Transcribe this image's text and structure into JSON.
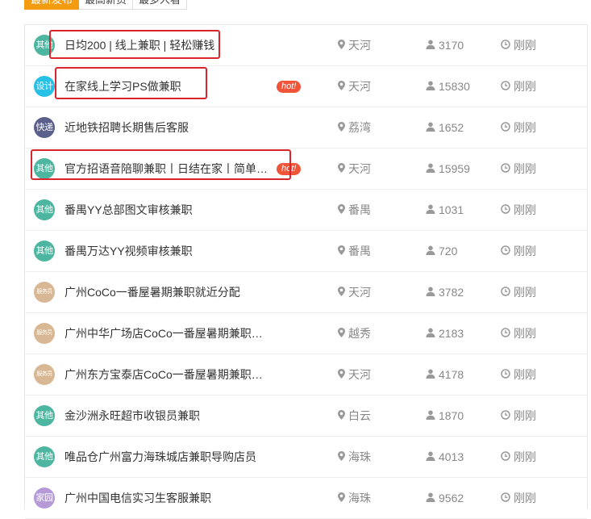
{
  "tabs": [
    "最新发布",
    "最高薪资",
    "最多人看"
  ],
  "jobs": [
    {
      "badge": "其他",
      "badge_kind": "other",
      "title": "日均200 | 线上兼职 | 轻松赚钱",
      "hot": "",
      "location": "天河",
      "views": "3170",
      "time": "刚刚"
    },
    {
      "badge": "设计",
      "badge_kind": "design",
      "title": "在家线上学习PS做兼职",
      "hot": "hot!",
      "location": "天河",
      "views": "15830",
      "time": "刚刚"
    },
    {
      "badge": "快递",
      "badge_kind": "express",
      "title": "近地铁招聘长期售后客服",
      "hot": "",
      "location": "荔湾",
      "views": "1652",
      "time": "刚刚"
    },
    {
      "badge": "其他",
      "badge_kind": "other",
      "title": "官方招语音陪聊兼职丨日结在家丨简单…",
      "hot": "hot!",
      "location": "天河",
      "views": "15959",
      "time": "刚刚"
    },
    {
      "badge": "其他",
      "badge_kind": "other",
      "title": "番禺YY总部图文审核兼职",
      "hot": "",
      "location": "番禺",
      "views": "1031",
      "time": "刚刚"
    },
    {
      "badge": "其他",
      "badge_kind": "other",
      "title": "番禺万达YY视频审核兼职",
      "hot": "",
      "location": "番禺",
      "views": "720",
      "time": "刚刚"
    },
    {
      "badge": "服务员",
      "badge_kind": "service",
      "title": "广州CoCo一番屋暑期兼职就近分配",
      "hot": "",
      "location": "天河",
      "views": "3782",
      "time": "刚刚"
    },
    {
      "badge": "服务员",
      "badge_kind": "service",
      "title": "广州中华广场店CoCo一番屋暑期兼职店员",
      "hot": "",
      "location": "越秀",
      "views": "2183",
      "time": "刚刚"
    },
    {
      "badge": "服务员",
      "badge_kind": "service",
      "title": "广州东方宝泰店CoCo一番屋暑期兼职店员",
      "hot": "",
      "location": "天河",
      "views": "4178",
      "time": "刚刚"
    },
    {
      "badge": "其他",
      "badge_kind": "other",
      "title": "金沙洲永旺超市收银员兼职",
      "hot": "",
      "location": "白云",
      "views": "1870",
      "time": "刚刚"
    },
    {
      "badge": "其他",
      "badge_kind": "other",
      "title": "唯品仓广州富力海珠城店兼职导购店员",
      "hot": "",
      "location": "海珠",
      "views": "4013",
      "time": "刚刚"
    },
    {
      "badge": "家园",
      "badge_kind": "shop",
      "title": "广州中国电信实习生客服兼职",
      "hot": "",
      "location": "海珠",
      "views": "9562",
      "time": "刚刚"
    }
  ],
  "icons": {
    "location": "map-pin-icon",
    "views": "person-icon",
    "time": "clock-icon"
  },
  "colors": {
    "accent": "#f39c12",
    "hot": "#f0553a",
    "highlight": "#d9262e"
  }
}
